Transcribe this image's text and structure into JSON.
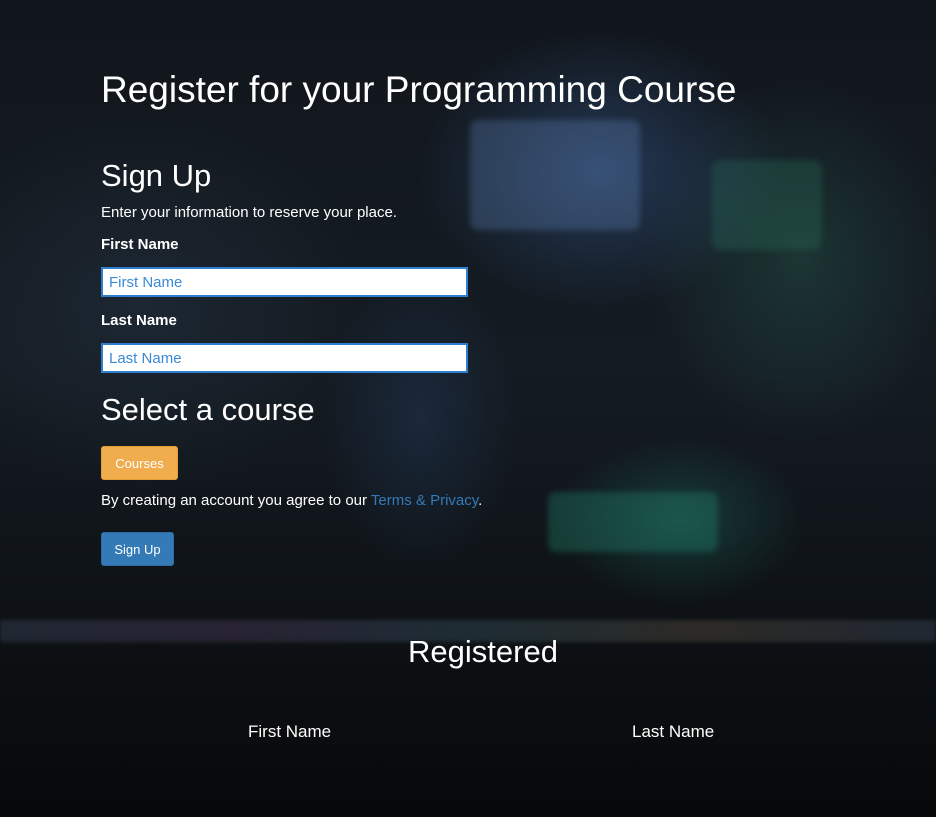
{
  "page": {
    "title": "Register for your Programming Course"
  },
  "signup": {
    "heading": "Sign Up",
    "intro": "Enter your information to reserve your place.",
    "first_name_label": "First Name",
    "first_name_placeholder": "First Name",
    "first_name_value": "",
    "last_name_label": "Last Name",
    "last_name_placeholder": "Last Name",
    "last_name_value": ""
  },
  "course": {
    "heading": "Select a course",
    "courses_button_label": "Courses"
  },
  "terms": {
    "prefix": "By creating an account you agree to our ",
    "link_text": "Terms & Privacy",
    "suffix": "."
  },
  "submit": {
    "label": "Sign Up"
  },
  "registered": {
    "heading": "Registered",
    "columns": [
      "First Name",
      "Last Name"
    ],
    "rows": []
  },
  "colors": {
    "courses_button": "#f0ad4e",
    "signup_button": "#337ab7",
    "link": "#337ab7",
    "input_border": "#2f7fd1",
    "text": "#ffffff"
  }
}
